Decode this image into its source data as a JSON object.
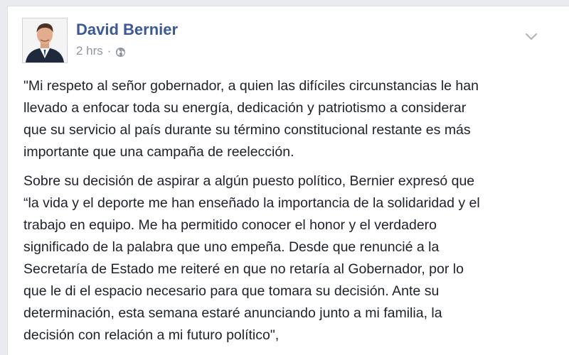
{
  "post": {
    "author": "David Bernier",
    "time": "2 hrs",
    "separator": "·",
    "privacy_icon": "globe-icon",
    "menu_icon": "chevron-down-icon",
    "paragraphs": [
      [
        "\"Mi respeto al señor gobernador, a quien las difíciles circunstancias le han",
        "llevado a enfocar toda su energía, dedicación y patriotismo a considerar",
        "que su servicio al país durante su término constitucional restante es más",
        "importante que una campaña de reelección."
      ],
      [
        "Sobre su decisión de aspirar a algún puesto político, Bernier expresó que",
        "“la vida y el deporte me han enseñado la importancia de la solidaridad y el",
        "trabajo en equipo. Me ha permitido conocer el honor y el verdadero",
        "significado de la palabra que uno empeña. Desde que renuncié a la",
        "Secretaría de Estado me reiteré en que no retaría al Gobernador, por lo",
        "que le di el espacio necesario para que tomara su decisión. Ante su",
        "determinación, esta semana estaré anunciando junto a mi familia, la",
        "decisión con relación a mi futuro político\","
      ]
    ]
  },
  "colors": {
    "author_link": "#3b5998",
    "meta_text": "#90949c",
    "body_text": "#1d2129",
    "page_bg": "#e9ebee",
    "card_bg": "#ffffff"
  }
}
